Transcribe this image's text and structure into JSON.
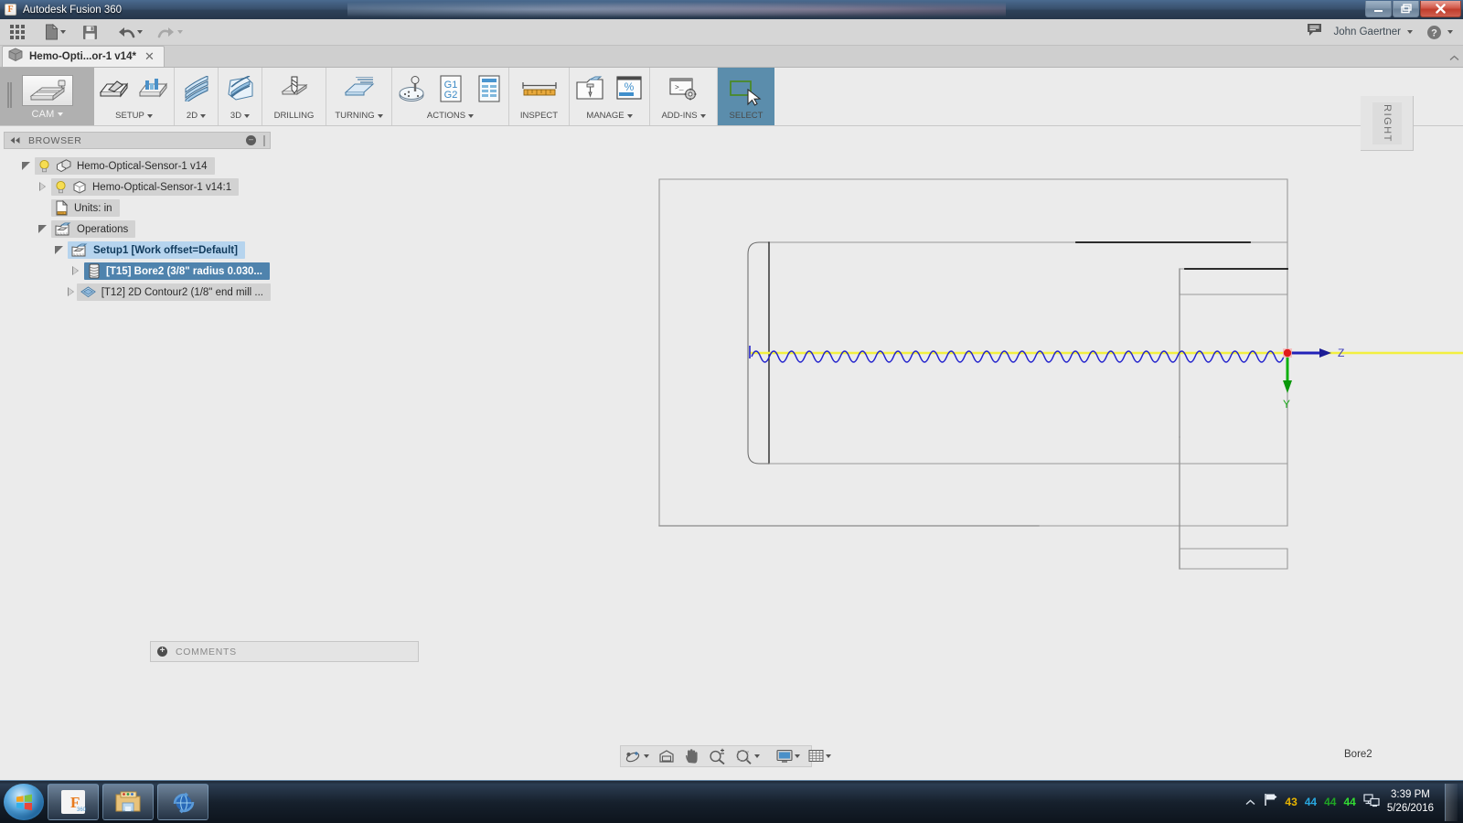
{
  "window": {
    "title": "Autodesk Fusion 360",
    "app_icon": "fusion-logo-icon",
    "controls": {
      "minimize": "minimize-icon",
      "restore": "restore-icon",
      "close": "close-icon"
    }
  },
  "apptop": {
    "buttons": [
      {
        "name": "app-grid",
        "icon": "grid-9-dots-icon",
        "caret": false
      },
      {
        "name": "file",
        "icon": "file-page-icon",
        "caret": true
      },
      {
        "name": "save",
        "icon": "floppy-save-icon",
        "caret": false
      },
      {
        "name": "undo",
        "icon": "undo-arrow-icon",
        "caret": true
      },
      {
        "name": "redo",
        "icon": "redo-arrow-icon",
        "caret": true
      }
    ],
    "comment_icon": "comment-balloon-icon",
    "username": "John Gaertner",
    "help_icon": "help-question-icon"
  },
  "tab": {
    "icon": "document-cube-icon",
    "label": "Hemo-Opti...or-1 v14*",
    "close": "✕"
  },
  "ribbon": {
    "workspace": {
      "label": "CAM",
      "icon": "cam-workspace-icon",
      "caret": true,
      "active": true
    },
    "groups": [
      {
        "name": "setup",
        "label": "SETUP",
        "caret": true,
        "items": [
          {
            "name": "new-setup",
            "icon": "new-setup-icon"
          },
          {
            "name": "setup-sheet",
            "icon": "setup-sheet-icon"
          }
        ]
      },
      {
        "name": "2d",
        "label": "2D",
        "caret": true,
        "items": [
          {
            "name": "2d-toolpaths",
            "icon": "2d-toolpath-icon"
          }
        ]
      },
      {
        "name": "3d",
        "label": "3D",
        "caret": true,
        "items": [
          {
            "name": "3d-toolpaths",
            "icon": "3d-toolpath-icon"
          }
        ]
      },
      {
        "name": "drilling",
        "label": "DRILLING",
        "caret": false,
        "items": [
          {
            "name": "drilling",
            "icon": "drill-icon"
          }
        ]
      },
      {
        "name": "turning",
        "label": "TURNING",
        "caret": true,
        "items": [
          {
            "name": "turning",
            "icon": "turning-icon"
          }
        ]
      },
      {
        "name": "actions",
        "label": "ACTIONS",
        "caret": true,
        "items": [
          {
            "name": "simulate",
            "icon": "simulate-joystick-icon"
          },
          {
            "name": "post-process",
            "icon": "g1-g2-post-icon"
          },
          {
            "name": "machining-time",
            "icon": "list-report-icon"
          }
        ]
      },
      {
        "name": "inspect",
        "label": "INSPECT",
        "caret": false,
        "items": [
          {
            "name": "measure",
            "icon": "ruler-measure-icon"
          }
        ]
      },
      {
        "name": "manage",
        "label": "MANAGE",
        "caret": true,
        "items": [
          {
            "name": "tool-library",
            "icon": "tool-library-icon"
          },
          {
            "name": "feed-optimization",
            "icon": "percent-feed-icon"
          }
        ]
      },
      {
        "name": "add-ins",
        "label": "ADD-INS",
        "caret": true,
        "items": [
          {
            "name": "scripts-and-addins",
            "icon": "console-gear-icon"
          }
        ]
      },
      {
        "name": "select",
        "label": "SELECT",
        "caret": false,
        "active": true,
        "items": [
          {
            "name": "select",
            "icon": "select-cursor-icon"
          }
        ]
      }
    ]
  },
  "browser": {
    "title": "BROWSER",
    "collapse_icon": "collapse-left-icon",
    "minimize_icon": "minus-circle-icon",
    "tree": [
      {
        "indent": 0,
        "expander": "open",
        "bulb": true,
        "icon": "assembly-icon",
        "label": "Hemo-Optical-Sensor-1 v14",
        "state": "normal"
      },
      {
        "indent": 1,
        "expander": "closed",
        "bulb": true,
        "icon": "component-box-icon",
        "label": "Hemo-Optical-Sensor-1 v14:1",
        "state": "normal"
      },
      {
        "indent": 1,
        "expander": "none",
        "bulb": false,
        "icon": "units-doc-icon",
        "label": "Units: in",
        "state": "normal"
      },
      {
        "indent": 1,
        "expander": "open",
        "bulb": false,
        "icon": "operations-folder-icon",
        "label": "Operations",
        "state": "normal"
      },
      {
        "indent": 2,
        "expander": "open",
        "bulb": false,
        "icon": "setup-folder-icon",
        "label": "Setup1 [Work offset=Default]",
        "state": "selected"
      },
      {
        "indent": 3,
        "expander": "closed",
        "bulb": false,
        "icon": "bore-operation-icon",
        "label": "[T15] Bore2 (3/8\" radius 0.030...",
        "state": "selected-strong"
      },
      {
        "indent": 3,
        "expander": "closed",
        "bulb": false,
        "icon": "contour-operation-icon",
        "label": "[T12] 2D Contour2 (1/8\" end mill ...",
        "state": "normal"
      }
    ]
  },
  "comments": {
    "label": "COMMENTS",
    "expand_icon": "plus-circle-icon"
  },
  "viewport": {
    "viewcube_label": "RIGHT",
    "axes": [
      {
        "name": "z-axis",
        "label": "Z",
        "color": "#2222b8"
      },
      {
        "name": "y-axis",
        "label": "Y",
        "color": "#0fb00f"
      }
    ],
    "origin_color": "#e01b1b",
    "toolpath_cut_color": "#2323cc",
    "toolpath_rapid_color": "#f2ef3f",
    "model_edge_color": "#1a1a1a",
    "model_silhouette_color": "#9a9a9a",
    "background": "#ebebeb"
  },
  "navbar": {
    "buttons": [
      {
        "name": "orbit",
        "icon": "orbit-icon",
        "caret": true
      },
      {
        "name": "look-at",
        "icon": "look-at-icon",
        "caret": false
      },
      {
        "name": "pan",
        "icon": "pan-hand-icon",
        "caret": false
      },
      {
        "name": "zoom",
        "icon": "zoom-plus-minus-icon",
        "caret": false
      },
      {
        "name": "fit",
        "icon": "zoom-fit-icon",
        "caret": true
      },
      {
        "name": "display-settings",
        "icon": "monitor-display-icon",
        "caret": true
      },
      {
        "name": "grid-snaps",
        "icon": "grid-snap-icon",
        "caret": true
      }
    ]
  },
  "status": {
    "right_label": "Bore2"
  },
  "taskbar": {
    "start_icon": "windows-start-orb-icon",
    "apps": [
      {
        "name": "fusion-360",
        "icon": "fusion-360-taskbar-icon",
        "active": true
      },
      {
        "name": "file-explorer",
        "icon": "folder-explorer-icon",
        "active": false
      },
      {
        "name": "web-browser",
        "icon": "globe-browser-icon",
        "active": false
      }
    ],
    "tray": {
      "chevron_icon": "chevron-up-icon",
      "flag_icon": "action-center-flag-icon",
      "numbers": [
        {
          "value": "43",
          "color": "#e8b400"
        },
        {
          "value": "44",
          "color": "#29a8e0"
        },
        {
          "value": "44",
          "color": "#1fa524"
        },
        {
          "value": "44",
          "color": "#33dd33"
        }
      ],
      "network_icon": "network-monitor-icon",
      "time": "3:39 PM",
      "date": "5/26/2016"
    }
  }
}
